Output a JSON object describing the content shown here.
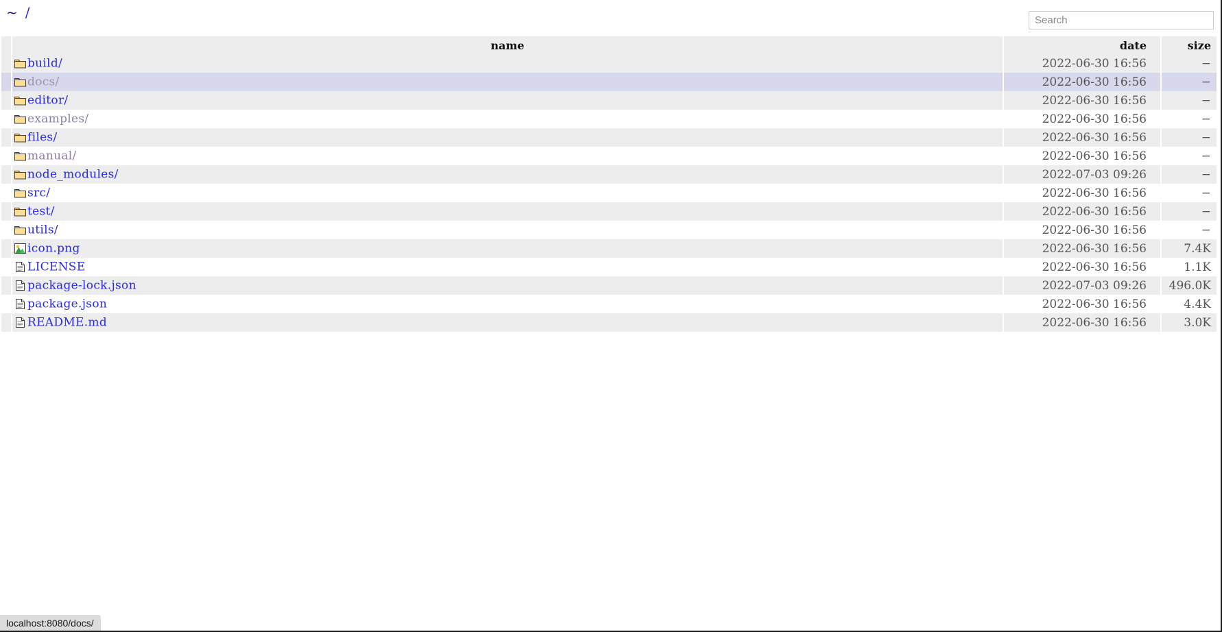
{
  "breadcrumb": {
    "home": "~",
    "separator": "/",
    "full_path": "~ /"
  },
  "search": {
    "placeholder": "Search",
    "value": ""
  },
  "table": {
    "columns": {
      "icon": "",
      "name": "name",
      "date": "date",
      "size": "size"
    },
    "rows": [
      {
        "icon": "folder-icon",
        "name": "build/",
        "date": "2022-06-30 16:56",
        "size": "−",
        "type": "directory",
        "state": "normal"
      },
      {
        "icon": "folder-icon",
        "name": "docs/",
        "date": "2022-06-30 16:56",
        "size": "−",
        "type": "directory",
        "state": "hovered"
      },
      {
        "icon": "folder-icon",
        "name": "editor/",
        "date": "2022-06-30 16:56",
        "size": "−",
        "type": "directory",
        "state": "normal"
      },
      {
        "icon": "folder-icon",
        "name": "examples/",
        "date": "2022-06-30 16:56",
        "size": "−",
        "type": "directory",
        "state": "visited"
      },
      {
        "icon": "folder-icon",
        "name": "files/",
        "date": "2022-06-30 16:56",
        "size": "−",
        "type": "directory",
        "state": "normal"
      },
      {
        "icon": "folder-icon",
        "name": "manual/",
        "date": "2022-06-30 16:56",
        "size": "−",
        "type": "directory",
        "state": "visited"
      },
      {
        "icon": "folder-icon",
        "name": "node_modules/",
        "date": "2022-07-03 09:26",
        "size": "−",
        "type": "directory",
        "state": "normal"
      },
      {
        "icon": "folder-icon",
        "name": "src/",
        "date": "2022-06-30 16:56",
        "size": "−",
        "type": "directory",
        "state": "normal"
      },
      {
        "icon": "folder-icon",
        "name": "test/",
        "date": "2022-06-30 16:56",
        "size": "−",
        "type": "directory",
        "state": "normal"
      },
      {
        "icon": "folder-icon",
        "name": "utils/",
        "date": "2022-06-30 16:56",
        "size": "−",
        "type": "directory",
        "state": "normal"
      },
      {
        "icon": "image-icon",
        "name": "icon.png",
        "date": "2022-06-30 16:56",
        "size": "7.4K",
        "type": "file",
        "state": "normal"
      },
      {
        "icon": "file-icon",
        "name": "LICENSE",
        "date": "2022-06-30 16:56",
        "size": "1.1K",
        "type": "file",
        "state": "normal"
      },
      {
        "icon": "file-icon",
        "name": "package-lock.json",
        "date": "2022-07-03 09:26",
        "size": "496.0K",
        "type": "file",
        "state": "normal"
      },
      {
        "icon": "file-icon",
        "name": "package.json",
        "date": "2022-06-30 16:56",
        "size": "4.4K",
        "type": "file",
        "state": "normal"
      },
      {
        "icon": "file-icon",
        "name": "README.md",
        "date": "2022-06-30 16:56",
        "size": "3.0K",
        "type": "file",
        "state": "normal"
      }
    ]
  },
  "statusbar": {
    "link_target": "localhost:8080/docs/"
  },
  "colors": {
    "link": "#2a2ae0",
    "link_visited": "#8f7fa8",
    "row_stripe": "#ededed",
    "row_hover": "#d8d8ec",
    "header_bg": "#ededed",
    "folder_icon": "#f5c96a",
    "statusbar_bg": "#dcdcdc"
  }
}
